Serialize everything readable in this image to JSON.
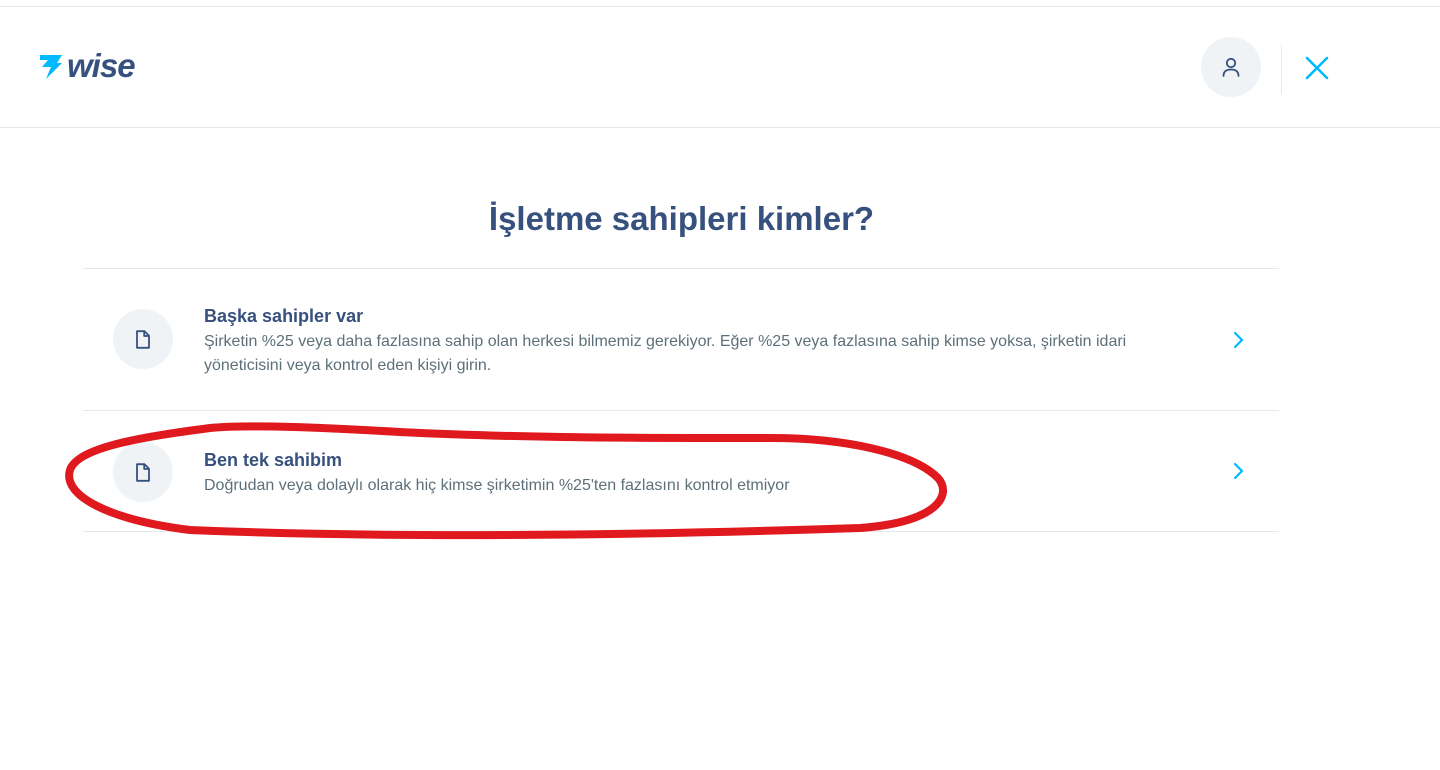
{
  "header": {
    "logo_text": "wise",
    "logo_icon": "wise-flag-icon",
    "account_icon": "user-icon",
    "close_icon": "close-icon"
  },
  "main": {
    "title": "İşletme sahipleri kimler?",
    "options": [
      {
        "title": "Başka sahipler var",
        "description": "Şirketin %25 veya daha fazlasına sahip olan herkesi bilmemiz gerekiyor. Eğer %25 veya fazlasına sahip kimse yoksa, şirketin idari yöneticisini veya kontrol eden kişiyi girin.",
        "icon": "document-icon"
      },
      {
        "title": "Ben tek sahibim",
        "description": "Doğrudan veya dolaylı olarak hiç kimse şirketimin %25'ten fazlasını kontrol etmiyor",
        "icon": "document-icon"
      }
    ]
  },
  "colors": {
    "brand_navy": "#37517e",
    "accent_blue": "#00b9ff",
    "body_text": "#5d7079",
    "icon_bg": "#f0f3f6",
    "divider": "#e6e8eb",
    "annotation_red": "#e0191e"
  }
}
